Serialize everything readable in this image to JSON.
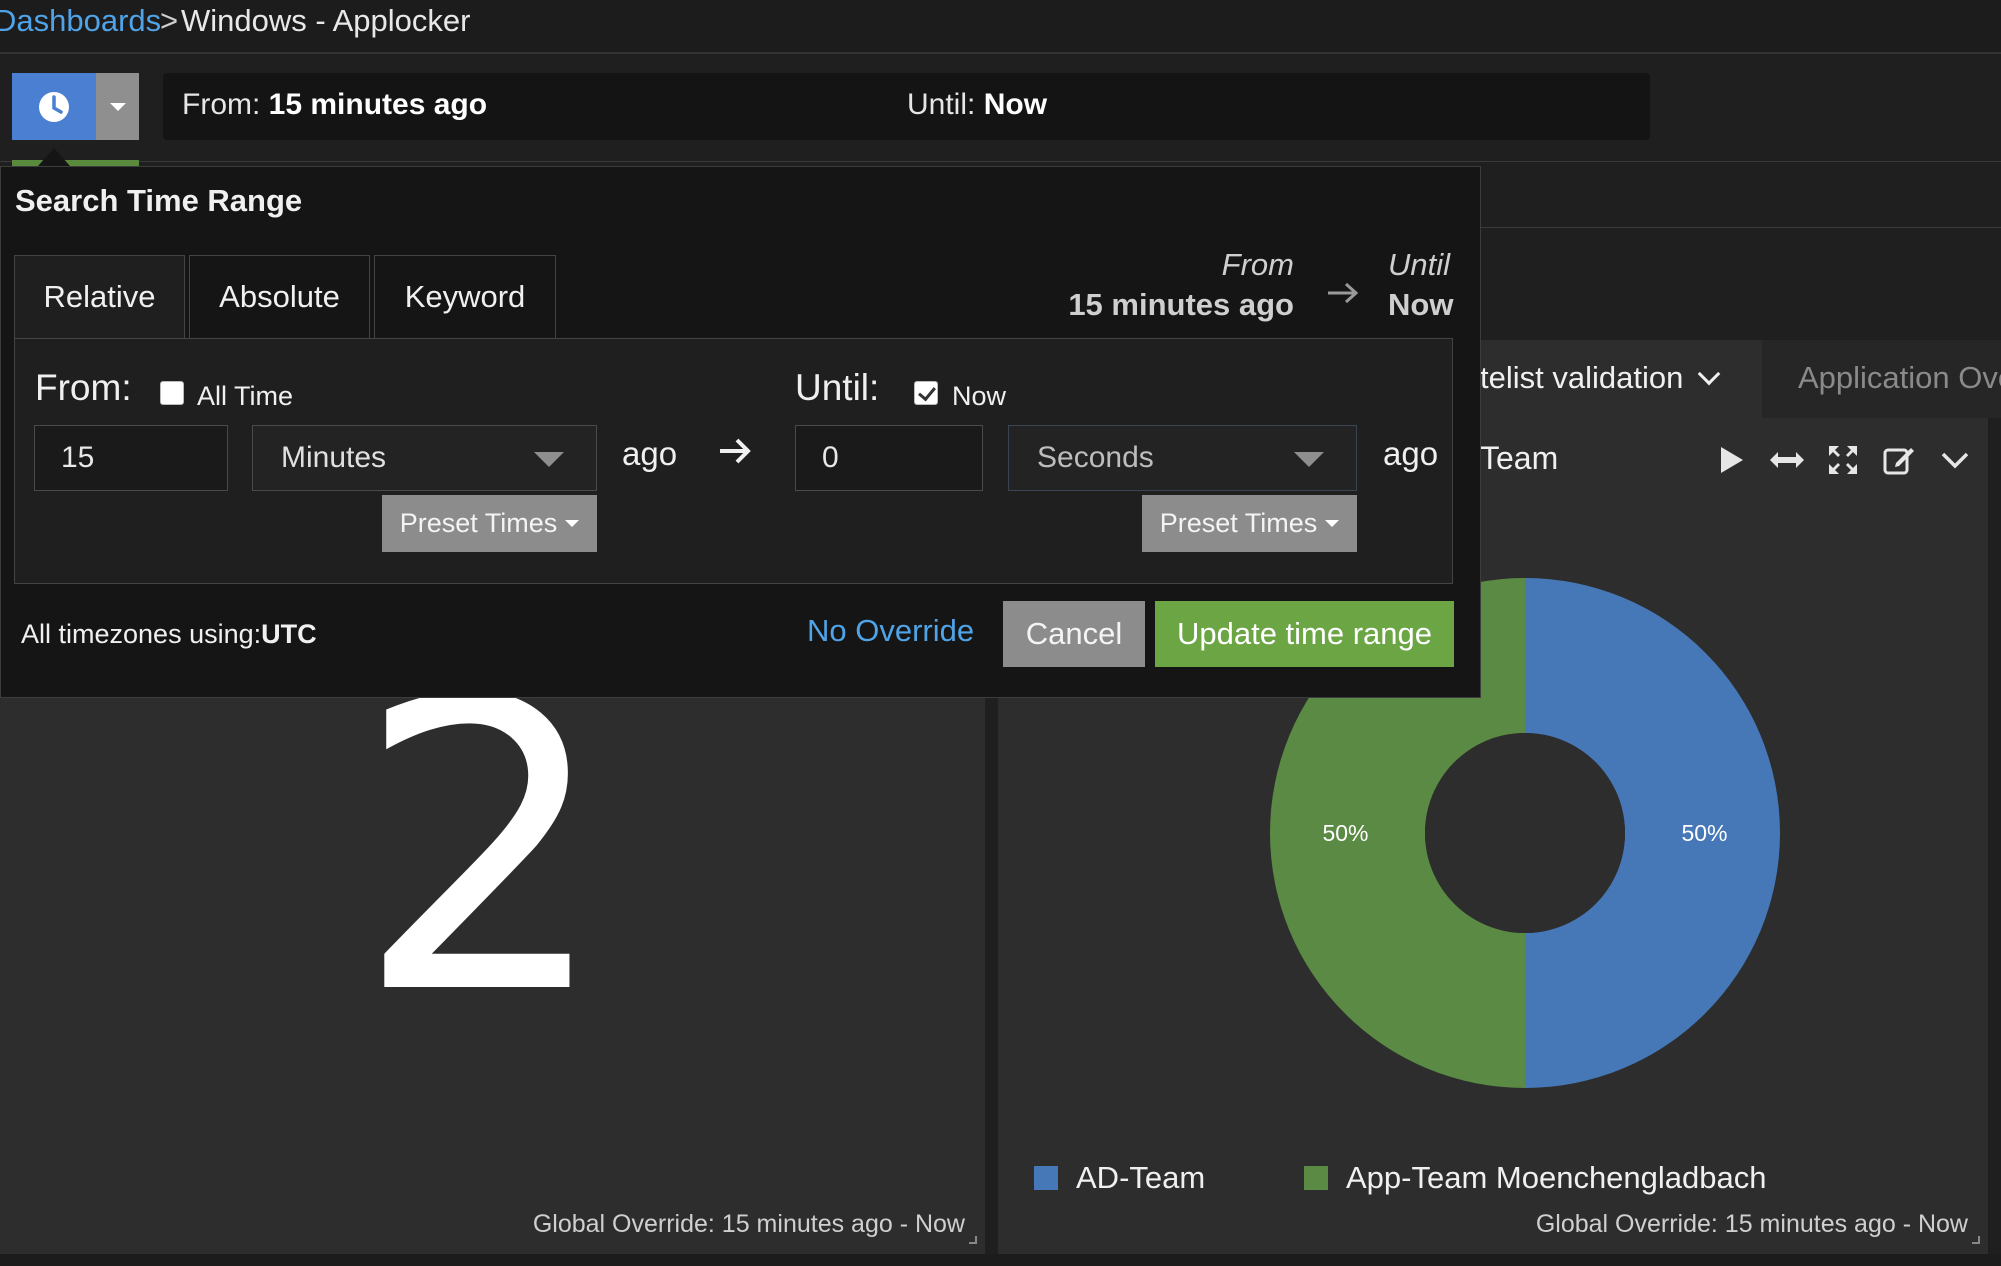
{
  "breadcrumb": {
    "link": "Dashboards",
    "separator": ">",
    "current": "Windows - Applocker"
  },
  "time_bar": {
    "from_label": "From:",
    "from_value": "15 minutes ago",
    "until_label": "Until:",
    "until_value": "Now"
  },
  "popover": {
    "title": "Search Time Range",
    "tabs": [
      "Relative",
      "Absolute",
      "Keyword"
    ],
    "summary": {
      "from_label": "From",
      "from_value": "15 minutes ago",
      "until_label": "Until",
      "until_value": "Now"
    },
    "from": {
      "label": "From:",
      "all_time_label": "All Time",
      "all_time_checked": false,
      "amount": "15",
      "unit": "Minutes",
      "ago": "ago",
      "preset_label": "Preset Times"
    },
    "until": {
      "label": "Until:",
      "now_label": "Now",
      "now_checked": true,
      "amount": "0",
      "unit": "Seconds",
      "ago": "ago",
      "preset_label": "Preset Times"
    },
    "timezone_prefix": "All timezones using:",
    "timezone": "UTC",
    "no_override": "No Override",
    "cancel": "Cancel",
    "update": "Update time range"
  },
  "dashboard": {
    "active_tab": "telist validation",
    "other_tab": "Application Ove",
    "panel_title": "Team",
    "big_number": "2",
    "override_text": "Global Override: 15 minutes ago - Now",
    "tool_icons": [
      "play-icon",
      "resize-horizontal-icon",
      "expand-icon",
      "edit-icon",
      "chevron-down-icon"
    ]
  },
  "colors": {
    "blue": "#4678b8",
    "green": "#5a8a44",
    "accent_link": "#4fa3e6",
    "update_button": "#6ca544"
  },
  "chart_data": {
    "type": "pie",
    "donut": true,
    "series": [
      {
        "name": "AD-Team",
        "value": 50,
        "label": "50%",
        "color": "#4678b8"
      },
      {
        "name": "App-Team Moenchengladbach",
        "value": 50,
        "label": "50%",
        "color": "#5a8a44"
      }
    ],
    "legend": "bottom"
  }
}
